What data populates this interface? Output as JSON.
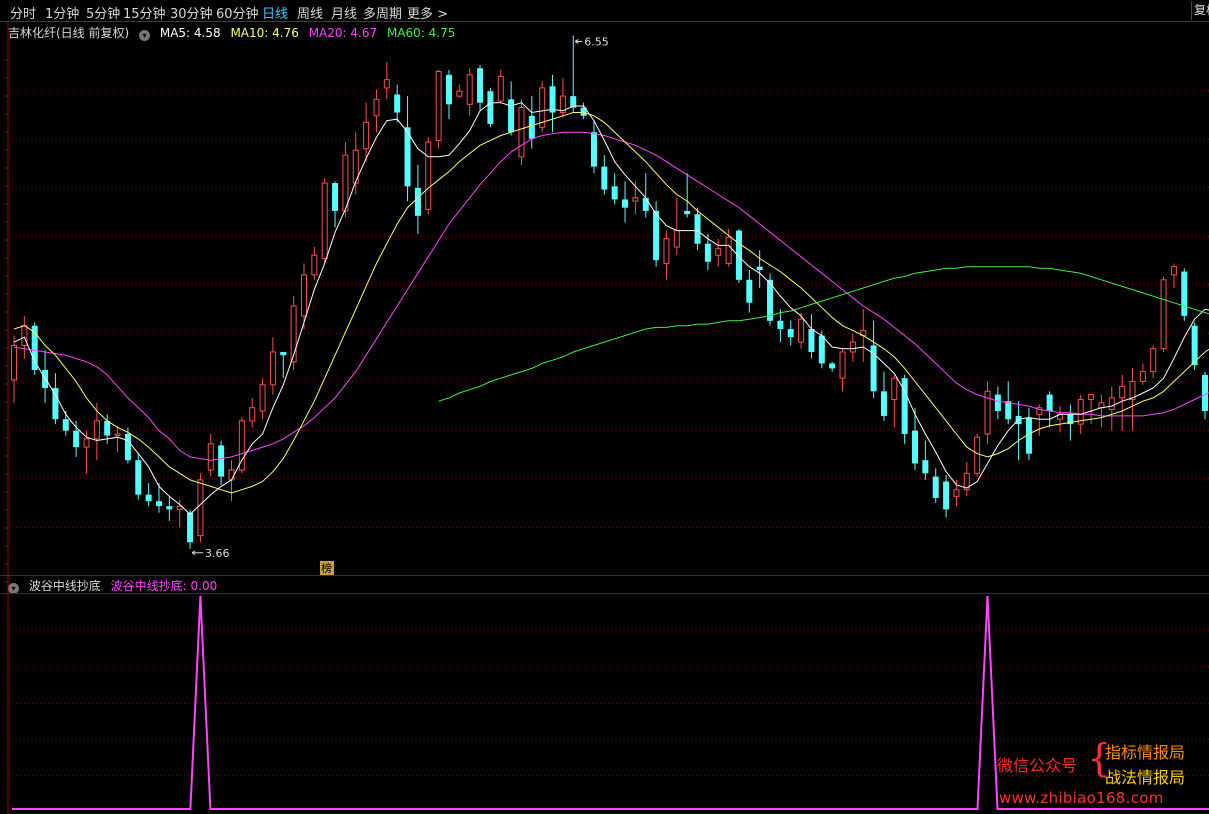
{
  "toolbar": {
    "periods": [
      "分时",
      "1分钟",
      "5分钟",
      "15分钟",
      "30分钟",
      "60分钟",
      "日线",
      "周线",
      "月线",
      "多周期",
      "更多 >"
    ],
    "active_index": 6,
    "fq_label": "复权"
  },
  "title_bar": {
    "stock_name": "吉林化纤(日线 前复权)",
    "ma5": "MA5: 4.58",
    "ma10": "MA10: 4.76",
    "ma20": "MA20: 4.67",
    "ma60": "MA60: 4.75"
  },
  "indicator_bar": {
    "name": "波谷中线抄底",
    "value_text": "波谷中线抄底: 0.00"
  },
  "badge": "榜",
  "watermark": {
    "account_label": "微信公众号",
    "brace": "{",
    "name1": "指标情报局",
    "name2": "战法情报局",
    "url": "www.zhibiao168.com"
  },
  "colors": {
    "up": "#ff4d4d",
    "down": "#54ffff",
    "ma5": "#ffffff",
    "ma10": "#ffff66",
    "ma20": "#ff44ff",
    "ma60": "#44ee44",
    "indicator": "#ff44ff",
    "grid": "#7a0000"
  },
  "chart_data": {
    "type": "candlestick",
    "ylim": [
      3.5,
      6.75
    ],
    "high_label": "6.55",
    "low_label": "3.66",
    "candles": [
      [
        4.69,
        4.96,
        4.55,
        4.9
      ],
      [
        4.9,
        5.08,
        4.82,
        5.02
      ],
      [
        5.02,
        5.04,
        4.72,
        4.75
      ],
      [
        4.75,
        4.87,
        4.55,
        4.64
      ],
      [
        4.64,
        4.73,
        4.42,
        4.45
      ],
      [
        4.45,
        4.5,
        4.35,
        4.38
      ],
      [
        4.38,
        4.44,
        4.22,
        4.28
      ],
      [
        4.28,
        4.38,
        4.12,
        4.33
      ],
      [
        4.33,
        4.55,
        4.2,
        4.44
      ],
      [
        4.44,
        4.48,
        4.3,
        4.35
      ],
      [
        4.35,
        4.41,
        4.25,
        4.36
      ],
      [
        4.36,
        4.4,
        4.18,
        4.2
      ],
      [
        4.2,
        4.24,
        3.96,
        3.99
      ],
      [
        3.99,
        4.06,
        3.92,
        3.95
      ],
      [
        3.95,
        4.06,
        3.88,
        3.92
      ],
      [
        3.92,
        3.98,
        3.83,
        3.9
      ],
      [
        3.9,
        3.96,
        3.79,
        3.92
      ],
      [
        3.88,
        3.9,
        3.66,
        3.7
      ],
      [
        3.74,
        4.12,
        3.7,
        4.08
      ],
      [
        4.14,
        4.36,
        4.1,
        4.3
      ],
      [
        4.29,
        4.32,
        4.05,
        4.1
      ],
      [
        4.08,
        4.2,
        3.95,
        4.14
      ],
      [
        4.14,
        4.46,
        4.12,
        4.44
      ],
      [
        4.44,
        4.58,
        4.4,
        4.52
      ],
      [
        4.5,
        4.7,
        4.45,
        4.66
      ],
      [
        4.66,
        4.95,
        4.6,
        4.86
      ],
      [
        4.86,
        4.86,
        4.7,
        4.84
      ],
      [
        4.8,
        5.2,
        4.75,
        5.14
      ],
      [
        5.08,
        5.4,
        5.0,
        5.33
      ],
      [
        5.33,
        5.5,
        5.3,
        5.45
      ],
      [
        5.43,
        5.92,
        5.4,
        5.89
      ],
      [
        5.89,
        5.9,
        5.62,
        5.72
      ],
      [
        5.72,
        6.14,
        5.68,
        6.06
      ],
      [
        5.89,
        6.2,
        5.82,
        6.09
      ],
      [
        6.1,
        6.38,
        6.02,
        6.26
      ],
      [
        6.3,
        6.46,
        6.2,
        6.4
      ],
      [
        6.47,
        6.63,
        6.4,
        6.52
      ],
      [
        6.43,
        6.49,
        6.26,
        6.32
      ],
      [
        6.23,
        6.42,
        5.78,
        5.87
      ],
      [
        5.86,
        6.0,
        5.58,
        5.69
      ],
      [
        5.73,
        6.17,
        5.7,
        6.14
      ],
      [
        6.15,
        6.58,
        6.1,
        6.57
      ],
      [
        6.55,
        6.58,
        6.28,
        6.37
      ],
      [
        6.42,
        6.49,
        6.41,
        6.45
      ],
      [
        6.37,
        6.59,
        6.3,
        6.55
      ],
      [
        6.59,
        6.61,
        6.33,
        6.38
      ],
      [
        6.45,
        6.47,
        6.23,
        6.25
      ],
      [
        6.39,
        6.58,
        6.38,
        6.54
      ],
      [
        6.4,
        6.51,
        6.18,
        6.2
      ],
      [
        6.05,
        6.4,
        6.0,
        6.35
      ],
      [
        6.3,
        6.42,
        6.1,
        6.16
      ],
      [
        6.23,
        6.51,
        6.2,
        6.47
      ],
      [
        6.48,
        6.55,
        6.2,
        6.32
      ],
      [
        6.32,
        6.53,
        6.29,
        6.42
      ],
      [
        6.42,
        6.79,
        6.32,
        6.35
      ],
      [
        6.35,
        6.38,
        6.28,
        6.3
      ],
      [
        6.2,
        6.27,
        5.95,
        5.99
      ],
      [
        5.99,
        6.06,
        5.82,
        5.85
      ],
      [
        5.87,
        5.95,
        5.76,
        5.79
      ],
      [
        5.79,
        5.9,
        5.65,
        5.74
      ],
      [
        5.78,
        5.9,
        5.7,
        5.8
      ],
      [
        5.8,
        5.95,
        5.68,
        5.72
      ],
      [
        5.72,
        5.78,
        5.38,
        5.42
      ],
      [
        5.4,
        5.6,
        5.3,
        5.55
      ],
      [
        5.5,
        5.8,
        5.45,
        5.6
      ],
      [
        5.72,
        5.95,
        5.68,
        5.7
      ],
      [
        5.7,
        5.74,
        5.48,
        5.52
      ],
      [
        5.52,
        5.58,
        5.36,
        5.41
      ],
      [
        5.45,
        5.55,
        5.38,
        5.49
      ],
      [
        5.4,
        5.61,
        5.38,
        5.56
      ],
      [
        5.6,
        5.61,
        5.28,
        5.3
      ],
      [
        5.3,
        5.36,
        5.1,
        5.16
      ],
      [
        5.38,
        5.48,
        5.25,
        5.36
      ],
      [
        5.3,
        5.34,
        5.02,
        5.05
      ],
      [
        5.05,
        5.12,
        4.92,
        5.0
      ],
      [
        5.0,
        5.05,
        4.9,
        4.95
      ],
      [
        4.92,
        5.1,
        4.88,
        5.06
      ],
      [
        5.0,
        5.09,
        4.82,
        4.86
      ],
      [
        4.96,
        4.99,
        4.76,
        4.79
      ],
      [
        4.79,
        4.8,
        4.74,
        4.76
      ],
      [
        4.7,
        4.88,
        4.62,
        4.86
      ],
      [
        4.86,
        4.97,
        4.8,
        4.92
      ],
      [
        4.96,
        5.12,
        4.8,
        4.99
      ],
      [
        4.9,
        5.05,
        4.58,
        4.62
      ],
      [
        4.62,
        4.74,
        4.44,
        4.47
      ],
      [
        4.57,
        4.72,
        4.4,
        4.7
      ],
      [
        4.7,
        4.72,
        4.3,
        4.36
      ],
      [
        4.38,
        4.52,
        4.14,
        4.18
      ],
      [
        4.2,
        4.32,
        4.08,
        4.12
      ],
      [
        4.1,
        4.15,
        3.94,
        3.97
      ],
      [
        4.07,
        4.11,
        3.85,
        3.9
      ],
      [
        3.98,
        4.08,
        3.92,
        4.02
      ],
      [
        4.02,
        4.19,
        3.98,
        4.12
      ],
      [
        4.12,
        4.36,
        4.1,
        4.34
      ],
      [
        4.36,
        4.68,
        4.3,
        4.62
      ],
      [
        4.6,
        4.65,
        4.45,
        4.5
      ],
      [
        4.56,
        4.68,
        4.42,
        4.45
      ],
      [
        4.47,
        4.56,
        4.2,
        4.42
      ],
      [
        4.46,
        4.52,
        4.2,
        4.24
      ],
      [
        4.48,
        4.54,
        4.35,
        4.52
      ],
      [
        4.6,
        4.62,
        4.4,
        4.5
      ],
      [
        4.45,
        4.53,
        4.37,
        4.48
      ],
      [
        4.48,
        4.54,
        4.32,
        4.42
      ],
      [
        4.42,
        4.6,
        4.36,
        4.57
      ],
      [
        4.57,
        4.6,
        4.42,
        4.6
      ],
      [
        4.52,
        4.6,
        4.4,
        4.55
      ],
      [
        4.51,
        4.65,
        4.38,
        4.58
      ],
      [
        4.58,
        4.72,
        4.38,
        4.65
      ],
      [
        4.57,
        4.76,
        4.38,
        4.68
      ],
      [
        4.68,
        4.79,
        4.66,
        4.74
      ],
      [
        4.74,
        4.9,
        4.7,
        4.88
      ],
      [
        4.88,
        5.32,
        4.86,
        5.3
      ],
      [
        5.33,
        5.4,
        5.25,
        5.38
      ],
      [
        5.35,
        5.37,
        5.05,
        5.08
      ],
      [
        5.02,
        5.04,
        4.75,
        4.78
      ],
      [
        4.72,
        4.74,
        4.45,
        4.5
      ]
    ],
    "ma5": [
      4.92,
      4.95,
      4.8,
      4.7,
      4.6,
      4.48,
      4.4,
      4.34,
      4.32,
      4.33,
      4.34,
      4.32,
      4.24,
      4.16,
      4.04,
      3.98,
      3.93,
      3.87,
      3.93,
      3.99,
      4.04,
      4.08,
      4.2,
      4.3,
      4.36,
      4.52,
      4.66,
      4.84,
      5.04,
      5.24,
      5.4,
      5.59,
      5.73,
      5.9,
      6.04,
      6.17,
      6.27,
      6.28,
      6.2,
      6.1,
      6.05,
      6.05,
      6.06,
      6.13,
      6.21,
      6.33,
      6.38,
      6.38,
      6.36,
      6.38,
      6.32,
      6.33,
      6.34,
      6.33,
      6.36,
      6.36,
      6.27,
      6.15,
      6.02,
      5.94,
      5.87,
      5.8,
      5.7,
      5.63,
      5.6,
      5.6,
      5.6,
      5.55,
      5.51,
      5.51,
      5.44,
      5.38,
      5.34,
      5.28,
      5.2,
      5.13,
      5.08,
      5.0,
      4.96,
      4.89,
      4.88,
      4.88,
      4.89,
      4.85,
      4.79,
      4.73,
      4.62,
      4.48,
      4.36,
      4.25,
      4.13,
      4.05,
      4.03,
      4.07,
      4.18,
      4.29,
      4.38,
      4.45,
      4.46,
      4.45,
      4.45,
      4.48,
      4.48,
      4.48,
      4.5,
      4.52,
      4.53,
      4.56,
      4.58,
      4.61,
      4.64,
      4.7,
      4.82,
      4.95,
      5.06,
      5.12,
      5.11,
      5.01
    ],
    "ma10": [
      5.0,
      5.02,
      4.98,
      4.9,
      4.84,
      4.76,
      4.68,
      4.58,
      4.5,
      4.44,
      4.4,
      4.37,
      4.33,
      4.28,
      4.22,
      4.16,
      4.12,
      4.08,
      4.06,
      4.04,
      4.02,
      4.0,
      4.02,
      4.04,
      4.07,
      4.13,
      4.21,
      4.32,
      4.44,
      4.56,
      4.7,
      4.84,
      4.98,
      5.12,
      5.26,
      5.4,
      5.52,
      5.64,
      5.74,
      5.8,
      5.86,
      5.91,
      5.96,
      6.02,
      6.07,
      6.12,
      6.15,
      6.18,
      6.2,
      6.22,
      6.24,
      6.26,
      6.28,
      6.3,
      6.32,
      6.32,
      6.3,
      6.26,
      6.2,
      6.14,
      6.08,
      6.02,
      5.95,
      5.88,
      5.82,
      5.78,
      5.72,
      5.67,
      5.62,
      5.57,
      5.52,
      5.48,
      5.43,
      5.39,
      5.35,
      5.3,
      5.25,
      5.19,
      5.13,
      5.07,
      5.02,
      4.99,
      4.96,
      4.92,
      4.88,
      4.83,
      4.76,
      4.68,
      4.6,
      4.52,
      4.44,
      4.36,
      4.28,
      4.24,
      4.22,
      4.24,
      4.27,
      4.32,
      4.36,
      4.39,
      4.41,
      4.42,
      4.43,
      4.44,
      4.45,
      4.46,
      4.48,
      4.5,
      4.53,
      4.56,
      4.58,
      4.62,
      4.68,
      4.74,
      4.8,
      4.86,
      4.9,
      4.92
    ],
    "ma20": [
      4.89,
      4.88,
      4.87,
      4.86,
      4.85,
      4.84,
      4.82,
      4.8,
      4.77,
      4.72,
      4.65,
      4.58,
      4.52,
      4.46,
      4.38,
      4.33,
      4.26,
      4.22,
      4.21,
      4.2,
      4.21,
      4.22,
      4.24,
      4.26,
      4.28,
      4.3,
      4.33,
      4.37,
      4.41,
      4.46,
      4.52,
      4.58,
      4.66,
      4.74,
      4.84,
      4.94,
      5.04,
      5.14,
      5.24,
      5.34,
      5.44,
      5.54,
      5.64,
      5.72,
      5.8,
      5.88,
      5.95,
      6.02,
      6.08,
      6.12,
      6.16,
      6.18,
      6.19,
      6.2,
      6.2,
      6.2,
      6.19,
      6.18,
      6.16,
      6.14,
      6.12,
      6.09,
      6.06,
      6.02,
      5.98,
      5.94,
      5.9,
      5.86,
      5.82,
      5.78,
      5.74,
      5.69,
      5.64,
      5.59,
      5.54,
      5.49,
      5.44,
      5.39,
      5.34,
      5.29,
      5.24,
      5.19,
      5.14,
      5.1,
      5.06,
      5.01,
      4.96,
      4.91,
      4.85,
      4.79,
      4.73,
      4.67,
      4.63,
      4.6,
      4.58,
      4.56,
      4.55,
      4.54,
      4.53,
      4.51,
      4.5,
      4.49,
      4.49,
      4.48,
      4.48,
      4.47,
      4.47,
      4.47,
      4.47,
      4.47,
      4.48,
      4.49,
      4.51,
      4.54,
      4.57,
      4.6,
      4.63,
      4.67
    ],
    "ma60_start": 41,
    "ma60": [
      4.56,
      4.58,
      4.61,
      4.63,
      4.65,
      4.68,
      4.7,
      4.72,
      4.74,
      4.76,
      4.79,
      4.81,
      4.83,
      4.86,
      4.88,
      4.9,
      4.92,
      4.94,
      4.96,
      4.98,
      5.0,
      5.01,
      5.01,
      5.02,
      5.02,
      5.03,
      5.03,
      5.04,
      5.05,
      5.05,
      5.06,
      5.07,
      5.08,
      5.1,
      5.11,
      5.13,
      5.15,
      5.17,
      5.19,
      5.21,
      5.23,
      5.25,
      5.27,
      5.29,
      5.31,
      5.32,
      5.34,
      5.35,
      5.36,
      5.37,
      5.37,
      5.38,
      5.38,
      5.38,
      5.38,
      5.38,
      5.38,
      5.38,
      5.37,
      5.37,
      5.36,
      5.35,
      5.34,
      5.32,
      5.3,
      5.28,
      5.26,
      5.24,
      5.22,
      5.2,
      5.18,
      5.16,
      5.14,
      5.12,
      5.1,
      5.08,
      5.06
    ],
    "indicator_peaks": [
      18,
      94
    ],
    "indicator_ylim": [
      0,
      1
    ]
  }
}
